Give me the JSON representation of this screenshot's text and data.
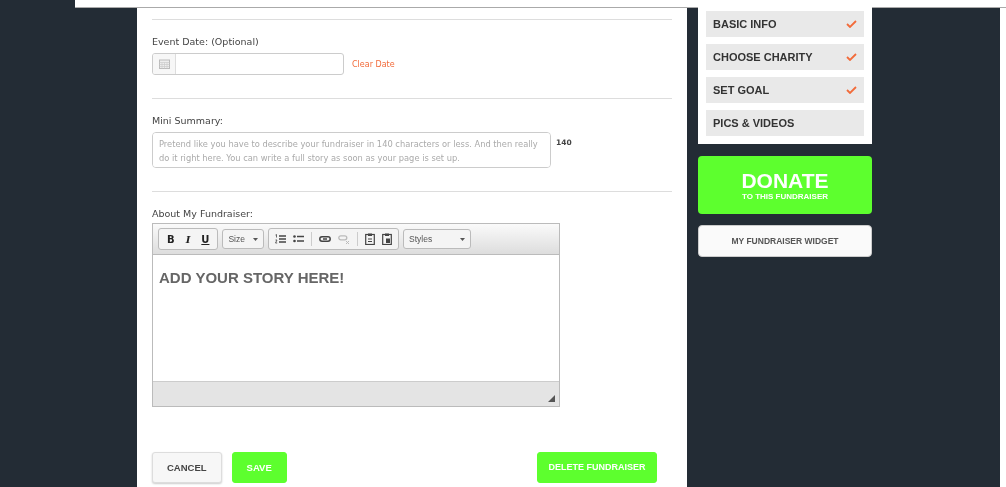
{
  "form": {
    "event_date": {
      "label": "Event Date: (Optional)",
      "clear_link": "Clear Date"
    },
    "mini_summary": {
      "label": "Mini Summary:",
      "placeholder": "Pretend like you have to describe your fundraiser in 140 characters or less. And then really do it right here. You can write a full story as soon as your page is set up.",
      "counter": "140"
    },
    "about": {
      "label": "About My Fundraiser:",
      "toolbar": {
        "format_buttons": [
          "B",
          "I",
          "U"
        ],
        "size_dropdown": "Size",
        "styles_dropdown": "Styles"
      },
      "content": "ADD YOUR STORY HERE!"
    },
    "buttons": {
      "cancel": "CANCEL",
      "save": "SAVE",
      "delete": "DELETE FUNDRAISER"
    }
  },
  "sidebar": {
    "steps": [
      {
        "label": "BASIC INFO",
        "completed": true
      },
      {
        "label": "CHOOSE CHARITY",
        "completed": true
      },
      {
        "label": "SET GOAL",
        "completed": true
      },
      {
        "label": "PICS & VIDEOS",
        "completed": false
      }
    ],
    "donate": {
      "title": "DONATE",
      "subtitle": "TO THIS FUNDRAISER"
    },
    "widget_button": "MY FUNDRAISER WIDGET"
  }
}
